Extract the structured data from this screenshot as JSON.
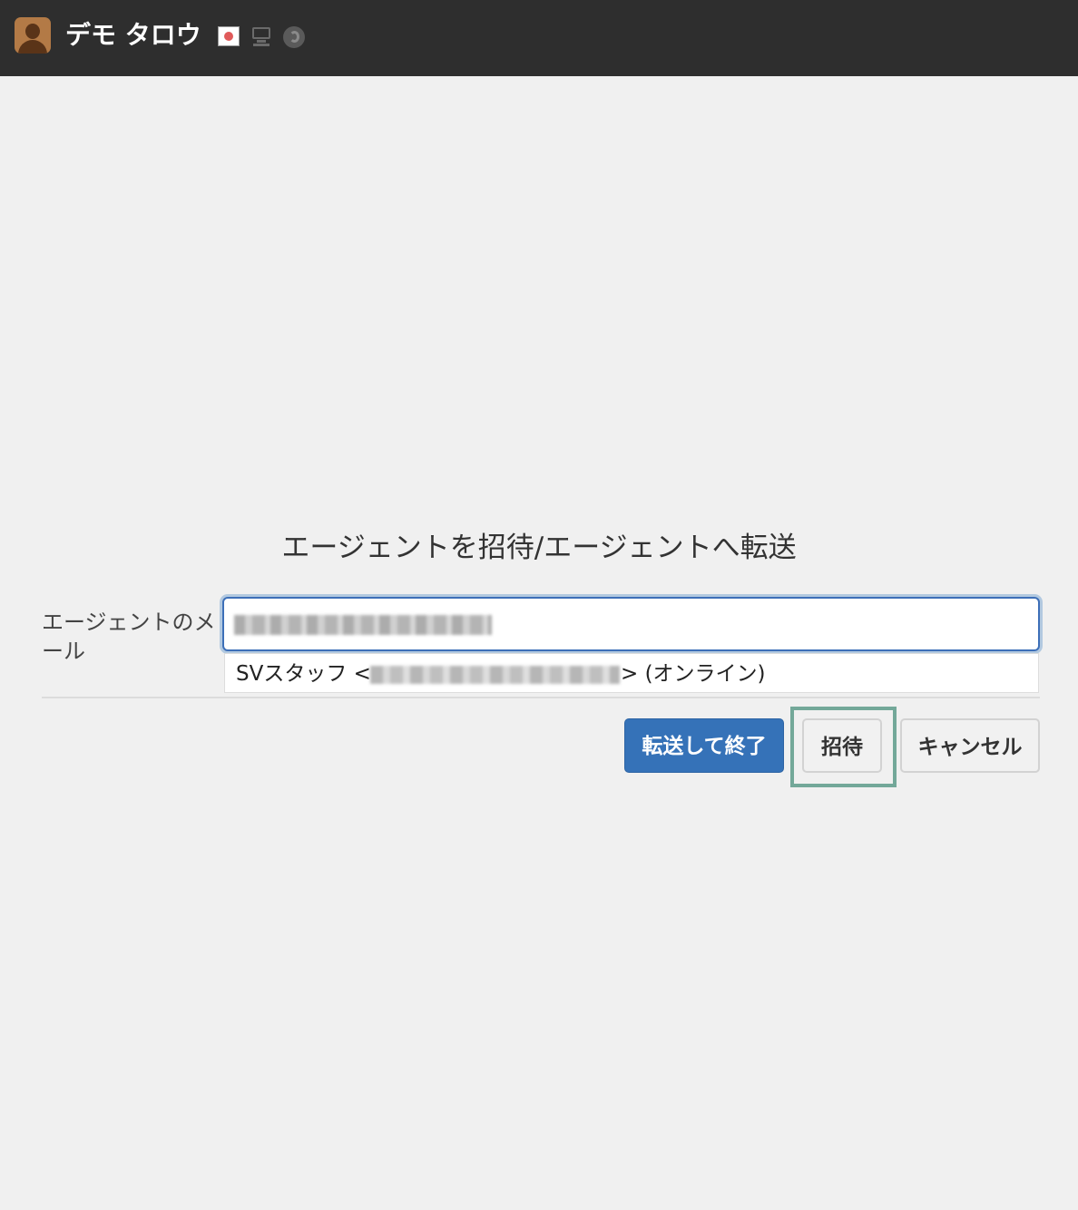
{
  "header": {
    "user_name": "デモ タロウ",
    "icons": [
      "avatar",
      "japan-flag-icon",
      "desktop-monitor-icon",
      "firefox-browser-icon"
    ]
  },
  "dialog": {
    "title": "エージェントを招待/エージェントへ転送",
    "field_label": "エージェントのメール",
    "email_input_value": "",
    "suggestion": {
      "name": "SVスタッフ <",
      "status": "> (オンライン)"
    },
    "buttons": {
      "transfer_and_end": "転送して終了",
      "invite": "招待",
      "cancel": "キャンセル"
    }
  },
  "colors": {
    "header_bg": "#2e2e2e",
    "page_bg": "#f0f0f0",
    "primary": "#3572b8",
    "highlight": "#73a899"
  }
}
